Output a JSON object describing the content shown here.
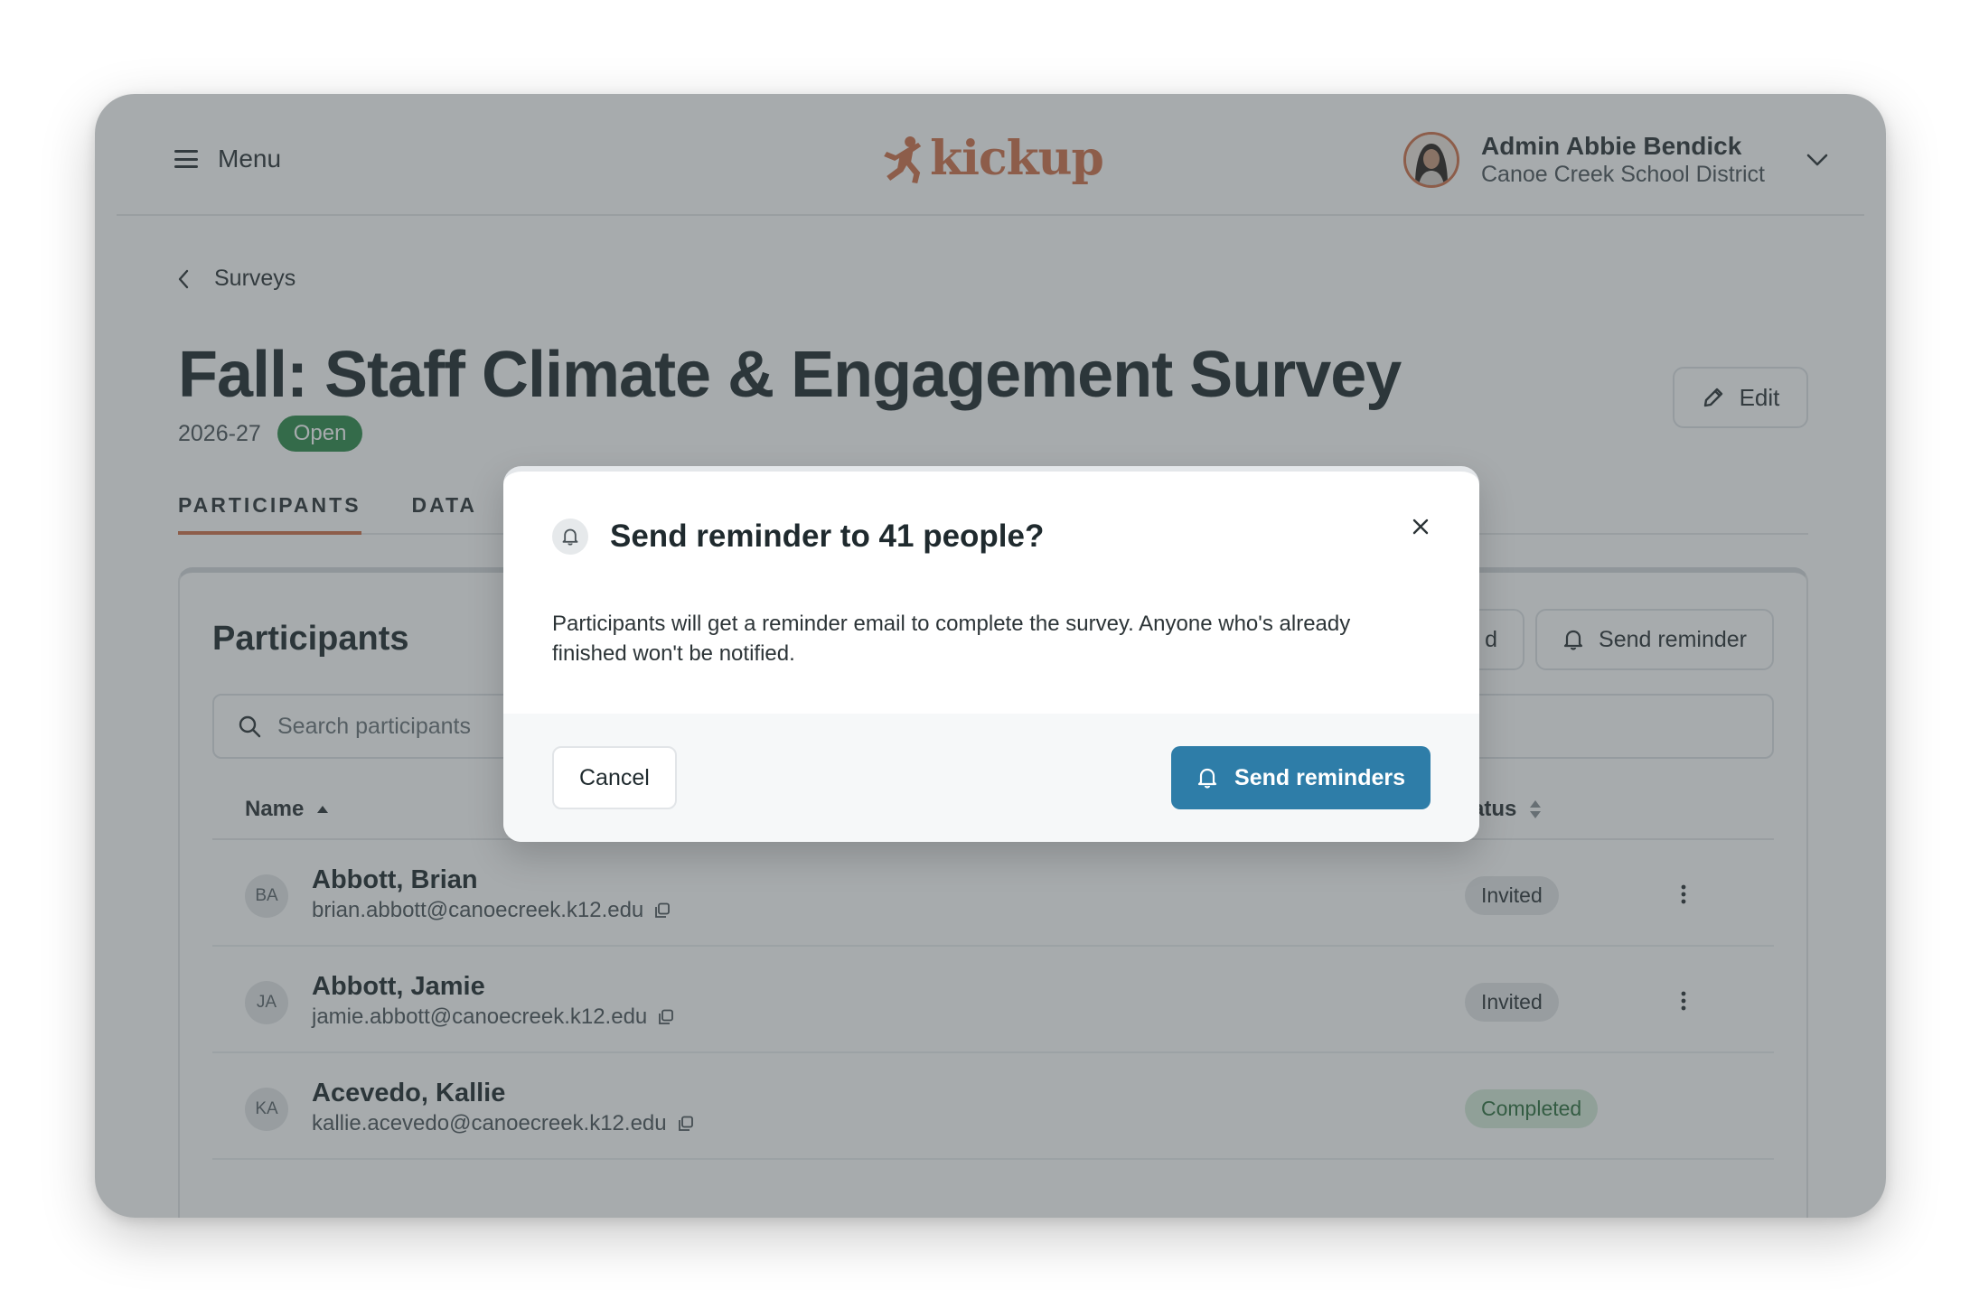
{
  "header": {
    "menu_label": "Menu",
    "logo_text": "kickup",
    "user_name": "Admin Abbie Bendick",
    "user_org": "Canoe Creek School District"
  },
  "breadcrumb": {
    "label": "Surveys"
  },
  "survey": {
    "title": "Fall: Staff Climate & Engagement Survey",
    "year": "2026-27",
    "status": "Open",
    "edit_label": "Edit"
  },
  "tabs": [
    {
      "label": "PARTICIPANTS",
      "active": true
    },
    {
      "label": "DATA",
      "active": false
    }
  ],
  "participants": {
    "title": "Participants",
    "partial_action_label": "d",
    "send_reminder_label": "Send reminder",
    "search_placeholder": "Search participants",
    "columns": {
      "name": "Name",
      "status": "tatus"
    },
    "rows": [
      {
        "initials": "BA",
        "name": "Abbott, Brian",
        "email": "brian.abbott@canoecreek.k12.edu",
        "status": "Invited"
      },
      {
        "initials": "JA",
        "name": "Abbott, Jamie",
        "email": "jamie.abbott@canoecreek.k12.edu",
        "status": "Invited"
      },
      {
        "initials": "KA",
        "name": "Acevedo, Kallie",
        "email": "kallie.acevedo@canoecreek.k12.edu",
        "status": "Completed"
      }
    ]
  },
  "modal": {
    "title": "Send reminder to 41 people?",
    "body": "Participants will get a reminder email to complete the survey. Anyone who's already finished won't be notified.",
    "cancel_label": "Cancel",
    "confirm_label": "Send reminders"
  },
  "colors": {
    "brand": "#d0724b",
    "primary": "#2e7da8",
    "open_badge": "#2f8a4b",
    "completed_badge": "#d5ecd9"
  },
  "icons": [
    "hamburger-icon",
    "kickup-runner-icon",
    "chevron-down-icon",
    "chevron-left-icon",
    "pencil-icon",
    "bell-icon",
    "search-icon",
    "sort-icon",
    "copy-icon",
    "kebab-icon",
    "close-icon"
  ]
}
